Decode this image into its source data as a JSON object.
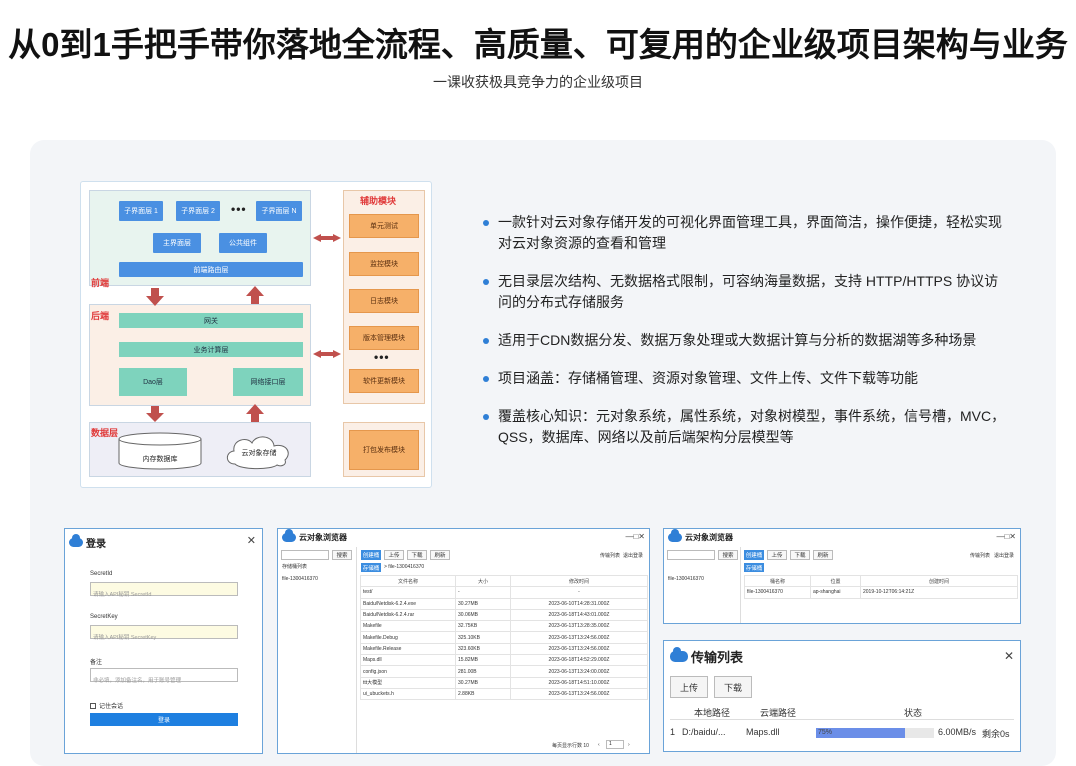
{
  "header": {
    "title": "从0到1手把手带你落地全流程、高质量、可复用的企业级项目架构与业务",
    "subtitle": "一课收获极具竞争力的企业级项目"
  },
  "colors": {
    "accent": "#2f7fd6",
    "panel_bg": "#f3f5f8",
    "diagram_red": "#e03a3a"
  },
  "architecture": {
    "front_label": "前端",
    "back_label": "后端",
    "data_label": "数据层",
    "aux_label": "辅助模块",
    "sub_layer_1": "子界面层 1",
    "sub_layer_2": "子界面层 2",
    "sub_layer_n": "子界面层 N",
    "main_layer": "主界面层",
    "common_component": "公共组件",
    "router_layer": "前端路由层",
    "gateway": "网关",
    "business_layer": "业务计算层",
    "dao_layer": "Dao层",
    "network_layer": "网络接口层",
    "memory_db": "内存数据库",
    "cloud_storage": "云对象存储",
    "ellipsis": "•••",
    "aux_modules": [
      "单元测试",
      "监控模块",
      "日志模块",
      "版本管理模块",
      "软件更新模块"
    ],
    "publish_module": "打包发布模块"
  },
  "bullets": [
    "一款针对云对象存储开发的可视化界面管理工具，界面简洁，操作便捷，轻松实现对云对象资源的查看和管理",
    "无目录层次结构、无数据格式限制，可容纳海量数据，支持 HTTP/HTTPS 协议访问的分布式存储服务",
    "适用于CDN数据分发、数据万象处理或大数据计算与分析的数据湖等多种场景",
    "项目涵盖：存储桶管理、资源对象管理、文件上传、文件下载等功能",
    "覆盖核心知识：元对象系统，属性系统，对象树模型，事件系统，信号槽，MVC，QSS，数据库、网络以及前后端架构分层模型等"
  ],
  "login": {
    "title": "登录",
    "secret_id_label": "SecretId",
    "secret_id_placeholder": "请输入API秘钥 SecretId",
    "secret_key_label": "SecretKey",
    "secret_key_placeholder": "请输入API秘钥 SecretKey",
    "note_label": "备注",
    "note_placeholder": "非必填，添加备注名，用于账号管理",
    "remember_label": "记住会话",
    "login_button": "登录"
  },
  "browser": {
    "title": "云对象浏览器",
    "search_button": "搜索",
    "bucket_list_label": "存储桶列表",
    "bucket_item": "file-1300416370",
    "tabs": [
      "创建桶",
      "上传",
      "下载",
      "刷新"
    ],
    "transfer_list": "传输列表",
    "logout": "退出登录",
    "storage_tag": "存储桶",
    "breadcrumb": "> file-1300416370",
    "columns": [
      "文件名称",
      "大小",
      "修改时间"
    ],
    "rows": [
      [
        "test/",
        "-",
        "-"
      ],
      [
        "Baidu/Netdisk-6.2.4.exe",
        "30.27MB",
        "2023-06-10T14:28:31.000Z"
      ],
      [
        "Baidu/Netdisk-6.2.4.rar",
        "30.06MB",
        "2023-06-18T14:43:01.000Z"
      ],
      [
        "Makefile",
        "32.75KB",
        "2023-06-13T13:28:35.000Z"
      ],
      [
        "Makefile.Debug",
        "325.10KB",
        "2023-06-13T13:24:56.000Z"
      ],
      [
        "Makefile.Release",
        "323.60KB",
        "2023-06-13T13:24:56.000Z"
      ],
      [
        "Maps.dll",
        "15.82MB",
        "2023-06-18T14:52:29.000Z"
      ],
      [
        "config.json",
        "281.00B",
        "2023-06-13T13:24:00.000Z"
      ],
      [
        "ttt大模型",
        "30.27MB",
        "2023-06-18T14:51:10.000Z"
      ],
      [
        "ui_ubuckets.h",
        "2.88KB",
        "2023-06-13T13:24:56.000Z"
      ]
    ],
    "page_info": "每页显示行数 10",
    "page_number": "1"
  },
  "browser2": {
    "title": "云对象浏览器",
    "search_button": "搜索",
    "bucket_item": "file-1300416370",
    "tabs": [
      "创建桶",
      "上传",
      "下载",
      "刷新"
    ],
    "transfer_list": "传输列表",
    "logout": "退出登录",
    "storage_tag": "存储桶",
    "columns": [
      "桶名称",
      "位置",
      "创建时间"
    ],
    "row": [
      "file-1300416370",
      "ap-shanghai",
      "2019-10-12T06:14:21Z"
    ]
  },
  "transfer": {
    "title": "传输列表",
    "upload_button": "上传",
    "download_button": "下载",
    "columns": [
      "本地路径",
      "云端路径",
      "状态"
    ],
    "row_index": "1",
    "local_path": "D:/baidu/...",
    "cloud_path": "Maps.dll",
    "progress_text": "75%",
    "progress_value": 0.75,
    "speed": "6.00MB/s",
    "remaining": "剩余0s"
  }
}
